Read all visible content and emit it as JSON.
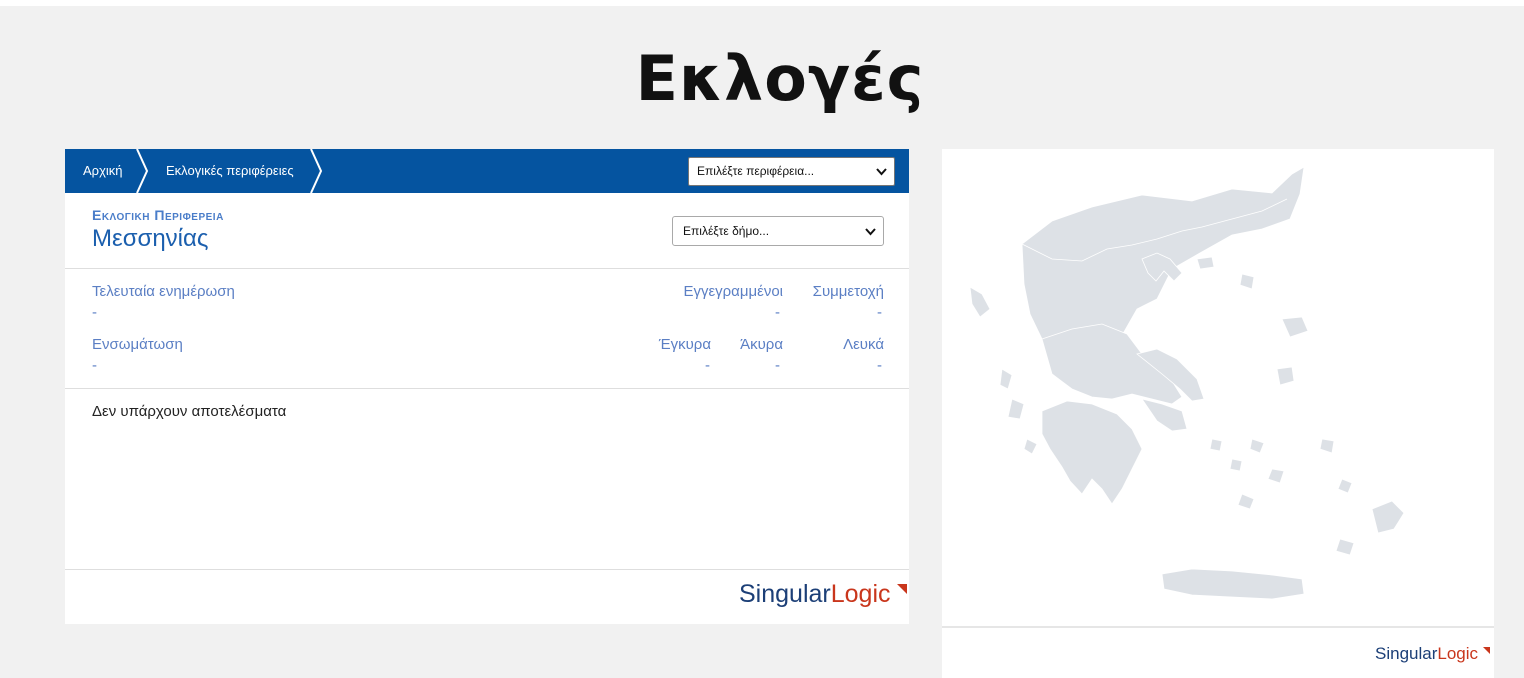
{
  "page": {
    "title": "Εκλογές"
  },
  "breadcrumb": {
    "items": [
      {
        "label": "Αρχική"
      },
      {
        "label": "Εκλογικές περιφέρειες"
      }
    ]
  },
  "region_select": {
    "selected": "Επιλέξτε περιφέρεια..."
  },
  "district": {
    "label": "Εκλογικη Περιφερεια",
    "name": "Μεσσηνίας"
  },
  "municipality_select": {
    "selected": "Επιλέξτε δήμο..."
  },
  "stats": {
    "last_update": {
      "label": "Τελευταία ενημέρωση",
      "value": "-"
    },
    "registered": {
      "label": "Εγγεγραμμένοι",
      "value": "-"
    },
    "turnout": {
      "label": "Συμμετοχή",
      "value": "-"
    },
    "integration": {
      "label": "Ενσωμάτωση",
      "value": "-"
    },
    "valid": {
      "label": "Έγκυρα",
      "value": "-"
    },
    "invalid": {
      "label": "Άκυρα",
      "value": "-"
    },
    "blank": {
      "label": "Λευκά",
      "value": "-"
    }
  },
  "results": {
    "empty_message": "Δεν υπάρχουν αποτελέσματα"
  },
  "logo": {
    "part1": "Singular",
    "part2": "Logic"
  },
  "map": {
    "fill": "#dde1e6",
    "stroke": "#ffffff"
  },
  "colors": {
    "nav_bg": "#0554a0",
    "accent": "#1b5fae",
    "label": "#5b7fc4",
    "logo_blue": "#1c3f77",
    "logo_red": "#c9361c"
  }
}
